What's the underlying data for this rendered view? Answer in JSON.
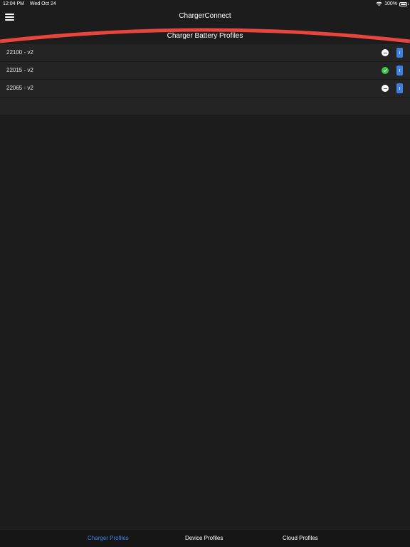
{
  "status_bar": {
    "time": "12:04 PM",
    "date": "Wed Oct 24",
    "battery_percent": "100%",
    "wifi_icon": "wifi-icon",
    "battery_icon": "battery-icon"
  },
  "header": {
    "title": "ChargerConnect",
    "menu_icon": "hamburger-menu-icon"
  },
  "section": {
    "title": "Charger Battery Profiles",
    "accent_color": "#e8453c"
  },
  "profiles": [
    {
      "label": "22100 - v2",
      "status": "inactive"
    },
    {
      "label": "22015 - v2",
      "status": "active"
    },
    {
      "label": "22065 - v2",
      "status": "inactive"
    }
  ],
  "tabs": [
    {
      "label": "Charger Profiles",
      "active": true
    },
    {
      "label": "Device Profiles",
      "active": false
    },
    {
      "label": "Cloud Profiles",
      "active": false
    }
  ],
  "colors": {
    "background": "#1c1c1c",
    "row": "#242424",
    "active_tab": "#3b82f0",
    "active_status": "#3bc44b",
    "info_button": "#3f7fe0"
  }
}
